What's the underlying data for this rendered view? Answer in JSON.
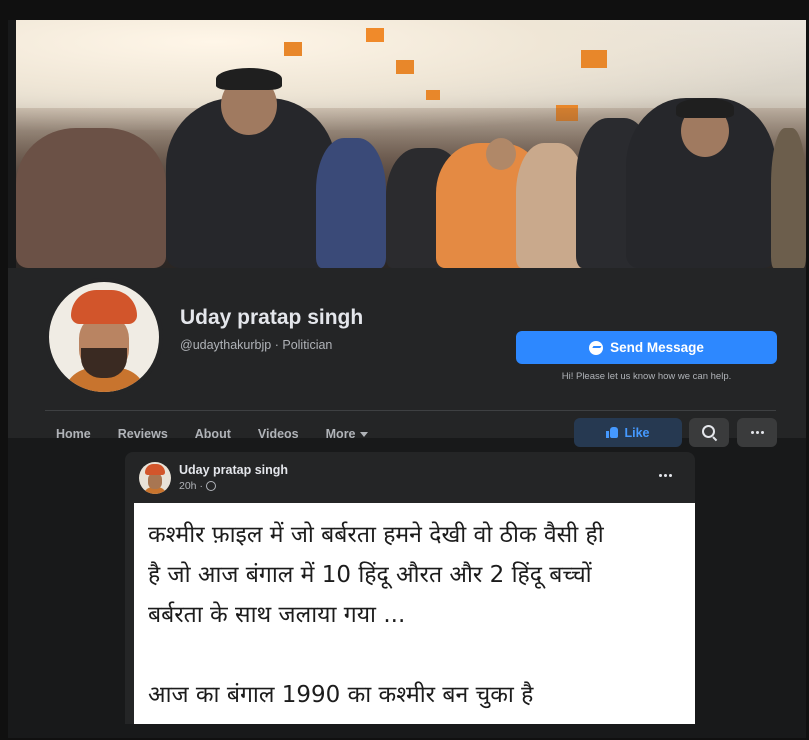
{
  "page": {
    "name": "Uday pratap singh",
    "handle": "@udaythakurbjp",
    "category": "Politician",
    "separator": "·"
  },
  "actions": {
    "send_message": "Send Message",
    "send_note": "Hi! Please let us know how we can help.",
    "like": "Like"
  },
  "nav": {
    "items": [
      {
        "label": "Home"
      },
      {
        "label": "Reviews"
      },
      {
        "label": "About"
      },
      {
        "label": "Videos"
      },
      {
        "label": "More"
      }
    ]
  },
  "post": {
    "author": "Uday pratap singh",
    "time": "20h",
    "meta_separator": "·",
    "lines": [
      "कश्मीर फ़ाइल में जो बर्बरता हमने देखी वो ठीक वैसी ही",
      "है जो आज बंगाल में 10 हिंदू औरत और 2 हिंदू बच्चों",
      "बर्बरता के साथ जलाया गया ...",
      "आज का बंगाल 1990 का कश्मीर बन चुका है"
    ]
  },
  "colors": {
    "background": "#18191a",
    "panel": "#242526",
    "primary": "#2d88ff",
    "like_bg": "#263951",
    "text_primary": "#e4e6eb",
    "text_secondary": "#b0b3b8"
  },
  "icons": [
    "messenger-icon",
    "like-thumb-icon",
    "search-icon",
    "more-options-icon",
    "globe-icon",
    "caret-down-icon"
  ]
}
